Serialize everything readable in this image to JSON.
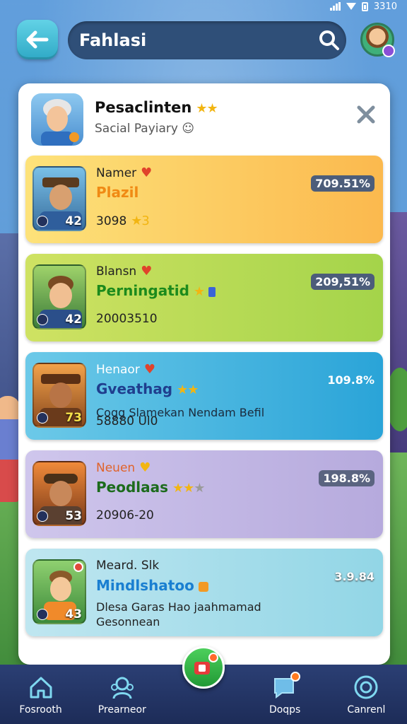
{
  "status_bar": {
    "time": "3310"
  },
  "header": {
    "search_value": "Fahlasi"
  },
  "panel": {
    "title": "Pesaclinten",
    "title_stars": "★★",
    "subtitle": "Sacial Payiary ☺"
  },
  "cards": [
    {
      "name": "Namer",
      "status": "Plazil",
      "stat": "3098",
      "stat_suffix": "★3",
      "percent": "709.51%",
      "level": "42",
      "status_color": "#f08a14"
    },
    {
      "name": "Blansn",
      "status": "Perningatid",
      "stat": "20003510",
      "percent": "209,51%",
      "level": "42",
      "status_color": "#1c8a1c"
    },
    {
      "name": "Henaor",
      "status": "Gveathag",
      "stat": "58880 Ul0",
      "overlay": "Cogg Slamekan Nendam Befil",
      "percent": "109.8%",
      "level": "73",
      "status_color": "#1f3e8e"
    },
    {
      "name": "Neuen",
      "status": "Peodlaas",
      "stat": "20906-20",
      "percent": "198.8%",
      "level": "53",
      "status_color": "#1c6b1c"
    },
    {
      "name": "Meard. Slk",
      "status": "Mindlshatoo",
      "desc_line1": "Dlesa Garas Hao jaahmamad",
      "desc_line2": "Gesonnean",
      "percent": "3.9.84",
      "level": "43",
      "status_color": "#1a7fd1"
    }
  ],
  "nav": [
    {
      "label": "Fosrooth",
      "icon": "home-icon"
    },
    {
      "label": "Prearneor",
      "icon": "friends-icon"
    },
    {
      "label": "",
      "icon": "camera-icon"
    },
    {
      "label": "Doqps",
      "icon": "chat-icon"
    },
    {
      "label": "Canrenl",
      "icon": "compass-icon"
    }
  ]
}
